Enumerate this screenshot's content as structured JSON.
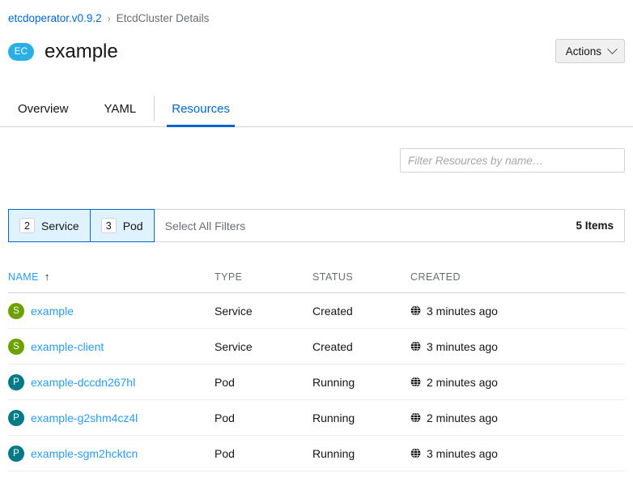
{
  "breadcrumb": {
    "parent": "etcdoperator.v0.9.2",
    "separator": "›",
    "current": "EtcdCluster Details"
  },
  "header": {
    "badge": "EC",
    "badge_color": "#2aaee6",
    "title": "example",
    "actions_label": "Actions",
    "actions_icon": "chevron-down-icon"
  },
  "tabs": [
    {
      "label": "Overview",
      "active": false
    },
    {
      "label": "YAML",
      "active": false
    },
    {
      "label": "Resources",
      "active": true
    }
  ],
  "search": {
    "placeholder": "Filter Resources by name…",
    "value": ""
  },
  "toolbar": {
    "filters": [
      {
        "count": "2",
        "label": "Service",
        "active": true
      },
      {
        "count": "3",
        "label": "Pod",
        "active": true
      }
    ],
    "select_all_label": "Select All Filters",
    "item_count": "5 Items",
    "active_color": "#0066cc",
    "active_bg": "#def3ff"
  },
  "table": {
    "columns": [
      {
        "label": "NAME",
        "sorted": true,
        "sort_icon": "↑"
      },
      {
        "label": "TYPE",
        "sorted": false
      },
      {
        "label": "STATUS",
        "sorted": false
      },
      {
        "label": "CREATED",
        "sorted": false
      }
    ],
    "rows": [
      {
        "badge": "S",
        "badge_kind": "kind-S",
        "badge_color": "#6ca100",
        "name": "example",
        "type": "Service",
        "status": "Created",
        "created": "3 minutes ago",
        "created_icon": "globe-icon"
      },
      {
        "badge": "S",
        "badge_kind": "kind-S",
        "badge_color": "#6ca100",
        "name": "example-client",
        "type": "Service",
        "status": "Created",
        "created": "3 minutes ago",
        "created_icon": "globe-icon"
      },
      {
        "badge": "P",
        "badge_kind": "kind-P",
        "badge_color": "#007a87",
        "name": "example-dccdn267hl",
        "type": "Pod",
        "status": "Running",
        "created": "2 minutes ago",
        "created_icon": "globe-icon"
      },
      {
        "badge": "P",
        "badge_kind": "kind-P",
        "badge_color": "#007a87",
        "name": "example-g2shm4cz4l",
        "type": "Pod",
        "status": "Running",
        "created": "2 minutes ago",
        "created_icon": "globe-icon"
      },
      {
        "badge": "P",
        "badge_kind": "kind-P",
        "badge_color": "#007a87",
        "name": "example-sgm2hcktcn",
        "type": "Pod",
        "status": "Running",
        "created": "3 minutes ago",
        "created_icon": "globe-icon"
      }
    ]
  }
}
